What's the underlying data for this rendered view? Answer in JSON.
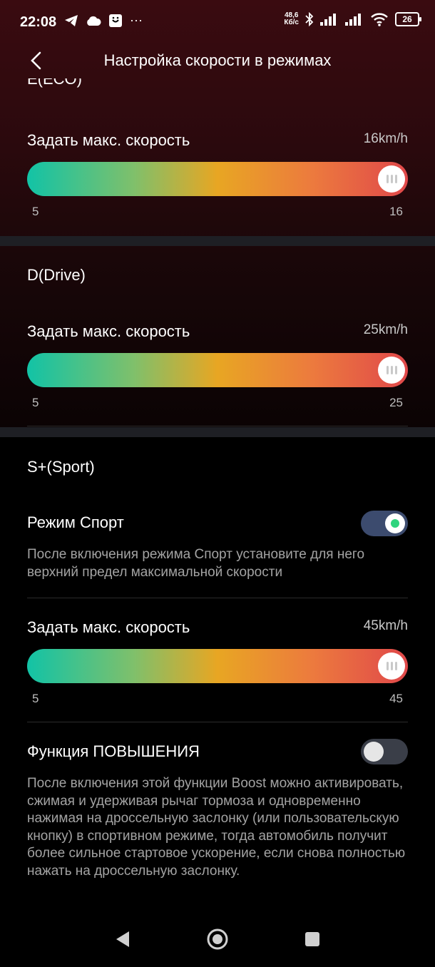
{
  "status": {
    "time": "22:08",
    "net_speed_value": "48,6",
    "net_speed_unit": "Кб/с",
    "battery": "26",
    "left_icons": [
      "telegram-icon",
      "cloud-icon",
      "notification-app-icon",
      "more-dots-icon"
    ],
    "more": "···"
  },
  "header": {
    "title": "Настройка скорости в режимах"
  },
  "eco": {
    "title": "E(ECO)",
    "label": "Задать макс. скорость",
    "value": "16km/h",
    "min": "5",
    "max": "16",
    "level": 1.0
  },
  "drive": {
    "title": "D(Drive)",
    "label": "Задать макс. скорость",
    "value": "25km/h",
    "min": "5",
    "max": "25",
    "level": 1.0
  },
  "sport": {
    "title": "S+(Sport)",
    "toggle_label": "Режим Спорт",
    "toggle_on": true,
    "toggle_desc": "После включения режима Спорт установите для него верхний предел максимальной скорости",
    "label": "Задать макс. скорость",
    "value": "45km/h",
    "min": "5",
    "max": "45",
    "level": 1.0
  },
  "boost": {
    "label": "Функция ПОВЫШЕНИЯ",
    "toggle_on": false,
    "desc": "После включения этой функции Boost можно активировать, сжимая и удерживая рычаг тормоза и одновременно нажимая на дроссельную заслонку (или пользовательскую кнопку) в спортивном режиме, тогда автомобиль получит более сильное стартовое ускорение, если снова полностью нажать на дроссельную заслонку."
  },
  "colors": {
    "slider_start": "#12c3a6",
    "slider_mid": "#e8a623",
    "slider_end": "#e0484a",
    "toggle_on_track": "#3c4b6e",
    "toggle_on_dot": "#2fd47e"
  }
}
